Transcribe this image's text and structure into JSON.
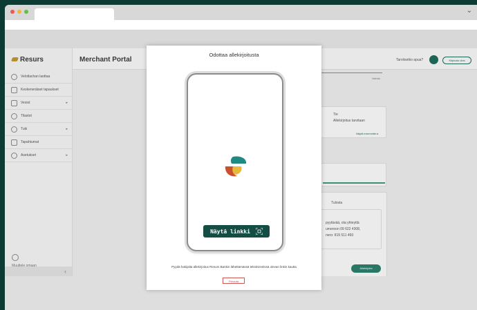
{
  "sidebar": {
    "logo": "Resurs",
    "items": [
      {
        "label": "Velotlachan laottaa",
        "icon": "gauge-icon",
        "chevron": ""
      },
      {
        "label": "Keskeneräiset tapaukset",
        "icon": "list-icon",
        "chevron": ""
      },
      {
        "label": "Vesist",
        "icon": "card-icon",
        "chevron": "▸"
      },
      {
        "label": "Tilastot",
        "icon": "chart-icon",
        "chevron": ""
      },
      {
        "label": "Tuki",
        "icon": "chat-icon",
        "chevron": "▸"
      },
      {
        "label": "Tapahtumat",
        "icon": "people-icon",
        "chevron": ""
      },
      {
        "label": "Asetukset",
        "icon": "gear-icon",
        "chevron": "▸"
      }
    ],
    "profile_label": "Muuttele omaan",
    "collapse_label": "‹"
  },
  "header": {
    "title": "Merchant Portal",
    "help_text": "Tarvitsetko apua?",
    "logout_label": "Kirjaudu ulos"
  },
  "content": {
    "step_left": "tuksen",
    "step_right": "Valmis",
    "card1_line1": "Tie",
    "card1_line2": "Allekirjoitus tarvitaan",
    "card1_link": "Näytä enemmän ▸",
    "card2_title": "Tulosta",
    "card2_line1": "pyytävää, ota yhteyttä",
    "card2_line2": "umeroon 09 622 4308,",
    "card2_line3": "nero: 815 511 460",
    "sign_button": "Allekirjoita"
  },
  "modal": {
    "title": "Odottaa allekirjoitusta",
    "show_link_button": "Näytä linkki",
    "instruction": "Pyydä hakijalta allekirjoitus Resurs Bankin lähettämässä tekstiviestissä olevan linkin kautta",
    "cancel_button": "Peruuta"
  },
  "colors": {
    "brand_dark_green": "#134d43",
    "brand_green": "#2d7f6c",
    "brand_yellow": "#e6b93a",
    "brand_red": "#c9512f",
    "brand_teal": "#1f8a82"
  }
}
